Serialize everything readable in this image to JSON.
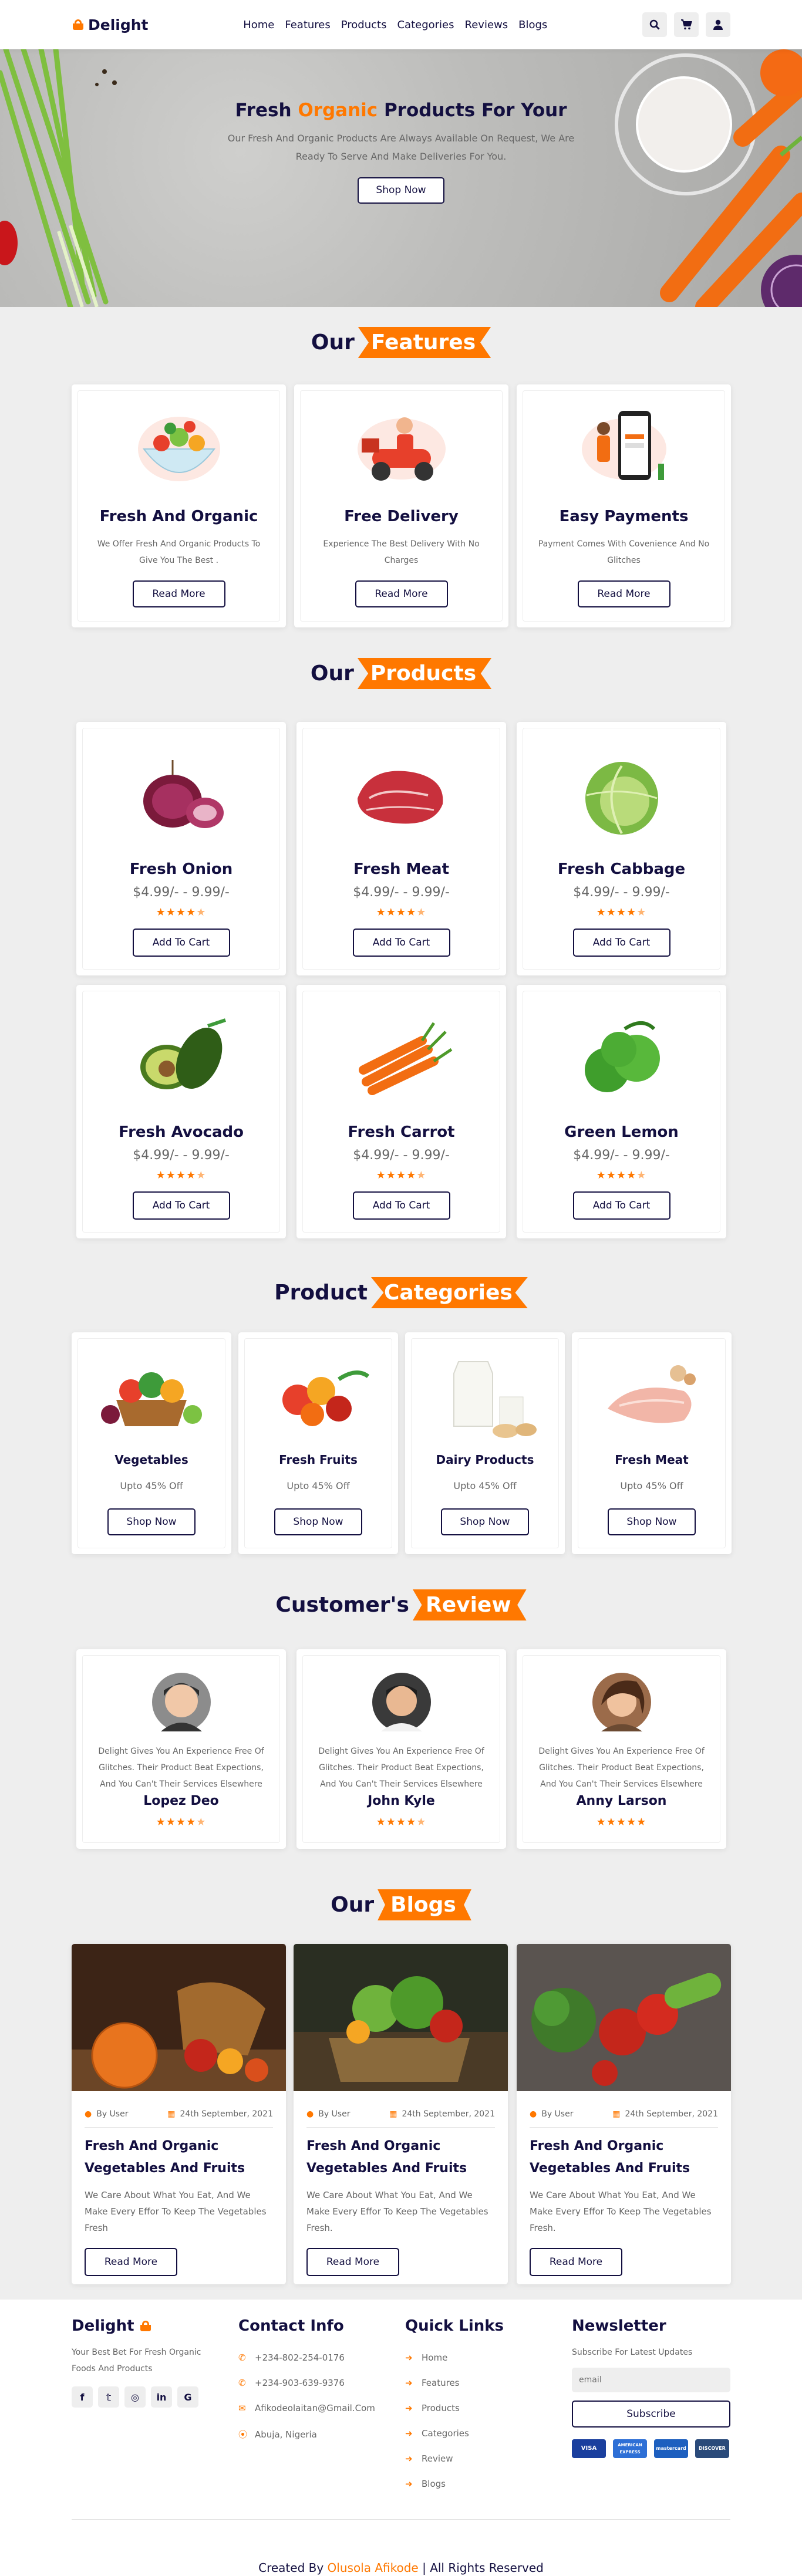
{
  "header": {
    "logo": "Delight",
    "nav": [
      "Home",
      "Features",
      "Products",
      "Categories",
      "Reviews",
      "Blogs"
    ]
  },
  "hero": {
    "title_a": "Fresh",
    "title_hl": "Organic",
    "title_b": "Products For Your",
    "desc": "Our Fresh And Organic Products Are Always Available On Request, We Are Ready To Serve And Make Deliveries For You.",
    "button": "Shop Now"
  },
  "features": {
    "heading_a": "Our",
    "heading_b": "Features",
    "items": [
      {
        "title": "Fresh And Organic",
        "desc": "We Offer Fresh And Organic Products To Give You The Best .",
        "button": "Read More"
      },
      {
        "title": "Free Delivery",
        "desc": "Experience The Best Delivery With No Charges",
        "button": "Read More"
      },
      {
        "title": "Easy Payments",
        "desc": "Payment Comes With Covenience And No Glitches",
        "button": "Read More"
      }
    ]
  },
  "products": {
    "heading_a": "Our",
    "heading_b": "Products",
    "items": [
      {
        "name": "Fresh Onion",
        "price": "$4.99/- - 9.99/-",
        "rating": 4.5,
        "button": "Add To Cart"
      },
      {
        "name": "Fresh Meat",
        "price": "$4.99/- - 9.99/-",
        "rating": 4.5,
        "button": "Add To Cart"
      },
      {
        "name": "Fresh Cabbage",
        "price": "$4.99/- - 9.99/-",
        "rating": 4.5,
        "button": "Add To Cart"
      },
      {
        "name": "Fresh Avocado",
        "price": "$4.99/- - 9.99/-",
        "rating": 4.5,
        "button": "Add To Cart"
      },
      {
        "name": "Fresh Carrot",
        "price": "$4.99/- - 9.99/-",
        "rating": 4.5,
        "button": "Add To Cart"
      },
      {
        "name": "Green Lemon",
        "price": "$4.99/- - 9.99/-",
        "rating": 4.5,
        "button": "Add To Cart"
      }
    ]
  },
  "categories": {
    "heading_a": "Product",
    "heading_b": "Categories",
    "items": [
      {
        "name": "Vegetables",
        "offer": "Upto 45% Off",
        "button": "Shop Now"
      },
      {
        "name": "Fresh Fruits",
        "offer": "Upto 45% Off",
        "button": "Shop Now"
      },
      {
        "name": "Dairy Products",
        "offer": "Upto 45% Off",
        "button": "Shop Now"
      },
      {
        "name": "Fresh Meat",
        "offer": "Upto 45% Off",
        "button": "Shop Now"
      }
    ]
  },
  "reviews": {
    "heading_a": "Customer's",
    "heading_b": "Review",
    "items": [
      {
        "name": "Lopez Deo",
        "text": "Delight Gives You An Experience Free Of Glitches. Their Product Beat Expections, And You Can't Their Services Elsewhere",
        "rating": 4.5
      },
      {
        "name": "John Kyle",
        "text": "Delight Gives You An Experience Free Of Glitches. Their Product Beat Expections, And You Can't Their Services Elsewhere",
        "rating": 4.5
      },
      {
        "name": "Anny Larson",
        "text": "Delight Gives You An Experience Free Of Glitches. Their Product Beat Expections, And You Can't Their Services Elsewhere",
        "rating": 5
      }
    ]
  },
  "blogs": {
    "heading_a": "Our",
    "heading_b": "Blogs",
    "items": [
      {
        "author": "By User",
        "date": "24th September, 2021",
        "title": "Fresh And Organic Vegetables And Fruits",
        "text": "We Care About What You Eat, And We Make Every Effor To Keep The Vegetables Fresh",
        "button": "Read More"
      },
      {
        "author": "By User",
        "date": "24th September, 2021",
        "title": "Fresh And Organic Vegetables And Fruits",
        "text": "We Care About What You Eat, And We Make Every Effor To Keep The Vegetables Fresh.",
        "button": "Read More"
      },
      {
        "author": "By User",
        "date": "24th September, 2021",
        "title": "Fresh And Organic Vegetables And Fruits",
        "text": "We Care About What You Eat, And We Make Every Effor To Keep The Vegetables Fresh.",
        "button": "Read More"
      }
    ]
  },
  "footer": {
    "brand": "Delight",
    "brand_desc": "Your Best Bet For Fresh Organic Foods And Products",
    "contact_title": "Contact Info",
    "phone1": "+234-802-254-0176",
    "phone2": "+234-903-639-9376",
    "email": "Afikodeolaitan@Gmail.Com",
    "location": "Abuja, Nigeria",
    "links_title": "Quick Links",
    "links": [
      "Home",
      "Features",
      "Products",
      "Categories",
      "Review",
      "Blogs"
    ],
    "news_title": "Newsletter",
    "news_desc": "Subscribe For Latest Updates",
    "email_placeholder": "email",
    "subscribe": "Subscribe",
    "cards": [
      "VISA",
      "AMERICAN EXPRESS",
      "mastercard",
      "DISCOVER"
    ],
    "credit_a": "Created By",
    "credit_name": "Olusola Afikode",
    "credit_b": "| All Rights Reserved"
  },
  "colors": {
    "accent": "#ff7800",
    "dark": "#130f40",
    "bg": "#eeeeee"
  }
}
